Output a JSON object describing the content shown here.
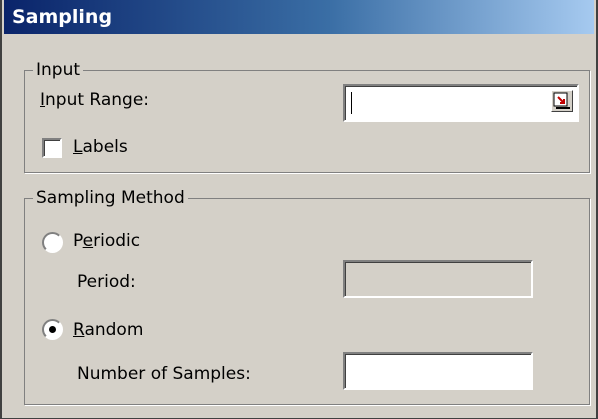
{
  "dialog": {
    "title": "Sampling"
  },
  "input_group": {
    "title": "Input",
    "input_range": {
      "label_prefix": "",
      "label_mnemonic": "I",
      "label_rest": "nput Range:",
      "value": ""
    },
    "labels": {
      "mnemonic": "L",
      "rest": "abels",
      "checked": false
    }
  },
  "method_group": {
    "title": "Sampling Method",
    "periodic": {
      "prefix": "P",
      "mnemonic": "e",
      "rest": "riodic",
      "selected": false
    },
    "period": {
      "label": "Period:",
      "value": ""
    },
    "random": {
      "mnemonic": "R",
      "rest": "andom",
      "selected": true
    },
    "num_samples": {
      "label": "Number of Samples:",
      "value": ""
    }
  },
  "icons": {
    "range_select": "range-picker-icon"
  }
}
